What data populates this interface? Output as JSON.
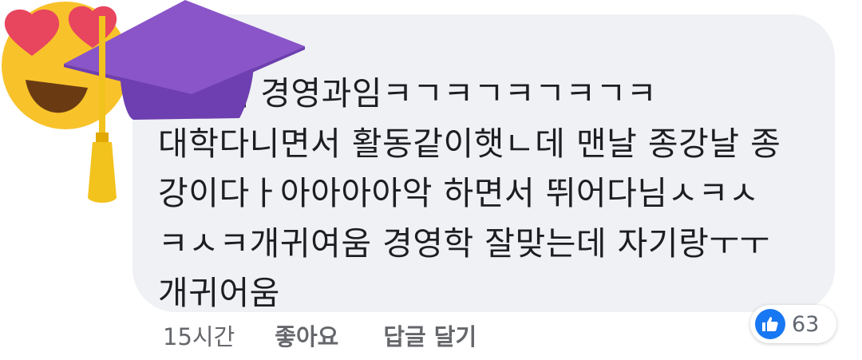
{
  "comment": {
    "text": "동국대 경영과임ㅋㄱㅋㄱㅋㄱㅋㄱㅋ\n대학다니면서 활동같이햇ㄴ데 맨날 종강날 종\n강이다ㅏ아아아아악 하면서 뛰어다님ㅅㅋㅅ\nㅋㅅㅋ개귀여움 경영학 잘맞는데 자기랑ㅜㅜ\n개귀어움"
  },
  "actions": {
    "time": "15시간",
    "like_label": "좋아요",
    "reply_label": "답글 달기"
  },
  "reactions": {
    "icon": "thumbs-up-icon",
    "count": "63"
  },
  "avatar": {
    "emoji": "heart-eyes-face",
    "accessory": "graduation-cap"
  },
  "colors": {
    "bubble": "#eff1f4",
    "text": "#1c1e21",
    "meta": "#65676b",
    "like_blue": "#1877f2",
    "cap_purple": "#8a55c8",
    "face_yellow": "#f8c22b"
  }
}
